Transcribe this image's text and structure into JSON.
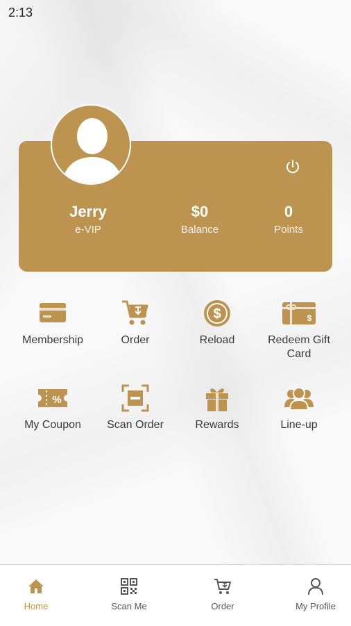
{
  "status_bar": {
    "time": "2:13"
  },
  "profile": {
    "name": "Jerry",
    "tier": "e-VIP",
    "balance_value": "$0",
    "balance_label": "Balance",
    "points_value": "0",
    "points_label": "Points"
  },
  "menu": [
    {
      "label": "Membership",
      "icon": "card-icon"
    },
    {
      "label": "Order",
      "icon": "cart-icon"
    },
    {
      "label": "Reload",
      "icon": "dollar-coin-icon"
    },
    {
      "label": "Redeem Gift Card",
      "icon": "gift-card-icon"
    },
    {
      "label": "My Coupon",
      "icon": "coupon-icon"
    },
    {
      "label": "Scan Order",
      "icon": "scan-icon"
    },
    {
      "label": "Rewards",
      "icon": "gift-icon"
    },
    {
      "label": "Line-up",
      "icon": "group-icon"
    }
  ],
  "bottom_nav": [
    {
      "label": "Home",
      "icon": "home-icon",
      "active": true
    },
    {
      "label": "Scan Me",
      "icon": "qr-code-icon",
      "active": false
    },
    {
      "label": "Order",
      "icon": "cart-icon",
      "active": false
    },
    {
      "label": "My Profile",
      "icon": "person-icon",
      "active": false
    }
  ],
  "colors": {
    "accent": "#bc934f",
    "inactive_nav": "#555555"
  }
}
